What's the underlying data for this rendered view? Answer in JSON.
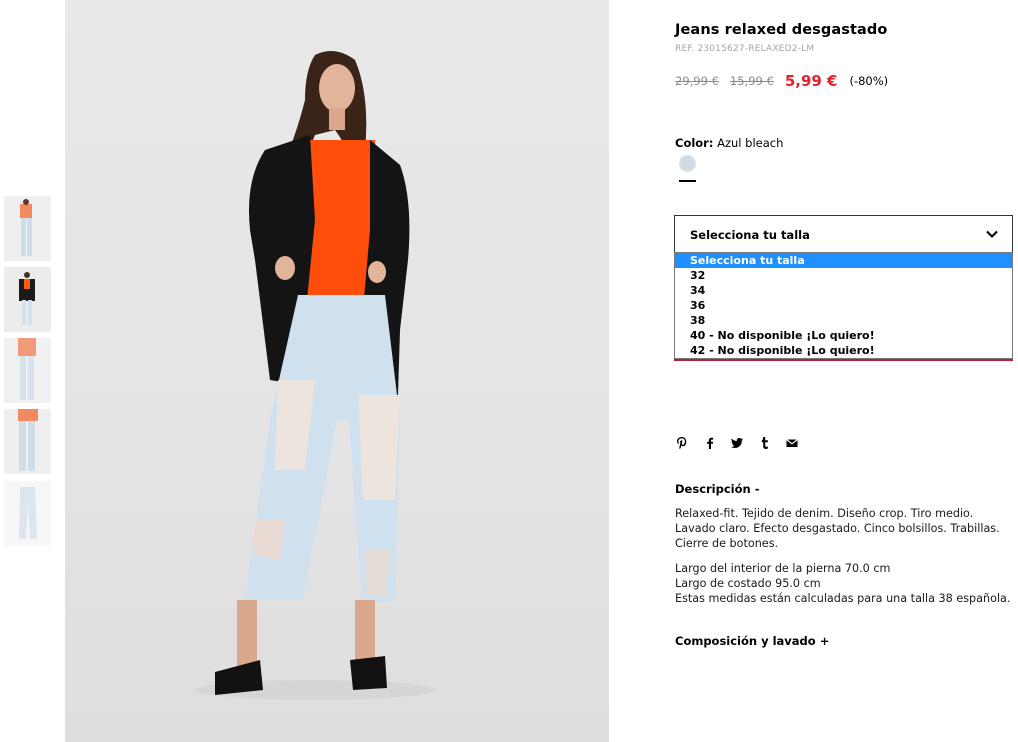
{
  "product": {
    "title": "Jeans relaxed desgastado",
    "ref": "REF. 23015627-RELAXED2-LM",
    "price_original": "29,99 €",
    "price_previous": "15,99 €",
    "price_sale": "5,99 €",
    "discount": "(-80%)"
  },
  "color": {
    "label": "Color:",
    "value": "Azul bleach"
  },
  "size_select": {
    "placeholder": "Selecciona tu talla",
    "options": [
      "Selecciona tu talla",
      "32",
      "34",
      "36",
      "38",
      "40 - No disponible ¡Lo quiero!",
      "42 - No disponible ¡Lo quiero!"
    ],
    "selected_index": 0
  },
  "share_icons": [
    "pinterest-icon",
    "facebook-icon",
    "twitter-icon",
    "tumblr-icon",
    "email-icon"
  ],
  "description": {
    "title": "Descripción  -",
    "text": "Relaxed-fit. Tejido de denim. Diseño crop. Tiro medio. Lavado claro. Efecto desgastado. Cinco bolsillos. Trabillas. Cierre de botones.",
    "measurements": [
      "Largo del interior de la pierna 70.0 cm",
      "Largo de costado 95.0 cm",
      "Estas medidas están calculadas para una talla 38 española."
    ]
  },
  "composition": {
    "title": "Composición y lavado  +"
  },
  "colors": {
    "sale_red": "#e0222c",
    "select_highlight": "#1e90ff",
    "swatch": "#cfdbe6"
  }
}
